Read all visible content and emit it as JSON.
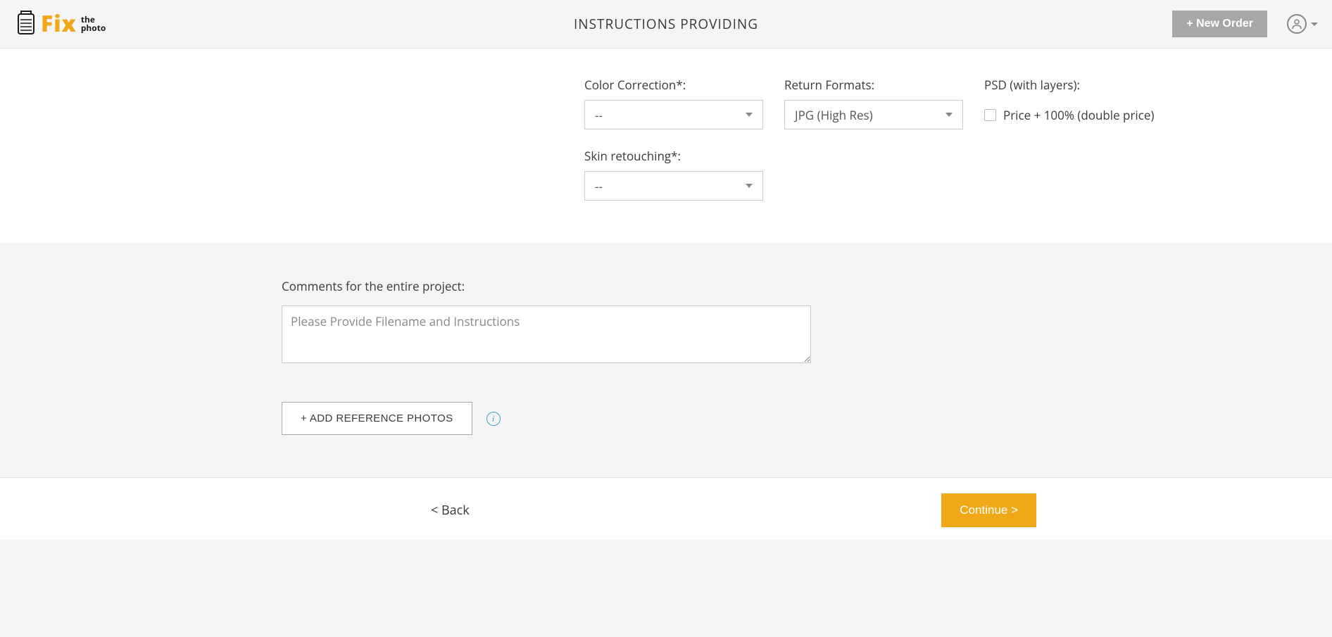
{
  "header": {
    "logo_main": "Fix",
    "logo_sub1": "the",
    "logo_sub2": "photo",
    "title": "INSTRUCTIONS PROVIDING",
    "new_order": "+ New Order"
  },
  "form": {
    "color_correction": {
      "label": "Color Correction*:",
      "value": "--"
    },
    "skin_retouching": {
      "label": "Skin retouching*:",
      "value": "--"
    },
    "return_formats": {
      "label": "Return Formats:",
      "value": "JPG (High Res)"
    },
    "psd": {
      "label": "PSD (with layers):",
      "checkbox_label": "Price + 100% (double price)"
    }
  },
  "comments": {
    "label": "Comments for the entire project:",
    "placeholder": "Please Provide Filename and Instructions",
    "ref_button": "+ ADD REFERENCE PHOTOS",
    "info_glyph": "i"
  },
  "footer": {
    "back": "< Back",
    "continue": "Continue >"
  }
}
